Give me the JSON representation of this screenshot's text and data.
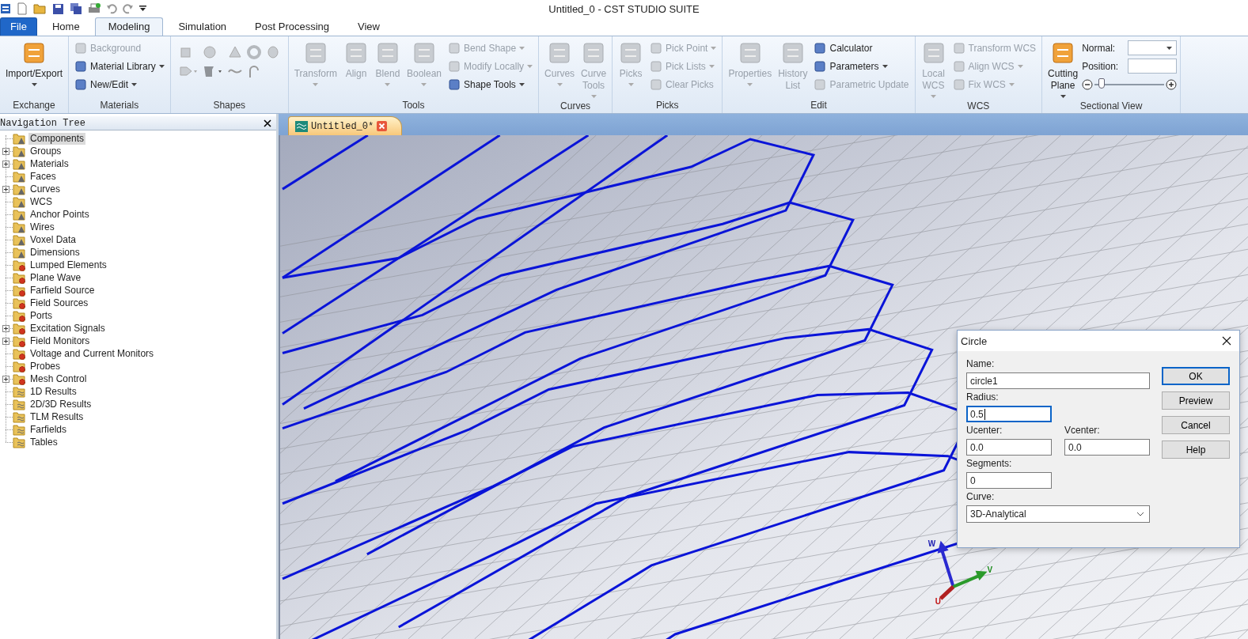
{
  "window": {
    "title": "Untitled_0 - CST STUDIO SUITE"
  },
  "ribbon": {
    "tabs": [
      {
        "label": "File",
        "kind": "file",
        "selected": false
      },
      {
        "label": "Home",
        "kind": "tab",
        "selected": false
      },
      {
        "label": "Modeling",
        "kind": "tab",
        "selected": true
      },
      {
        "label": "Simulation",
        "kind": "tab",
        "selected": false
      },
      {
        "label": "Post Processing",
        "kind": "tab",
        "selected": false
      },
      {
        "label": "View",
        "kind": "tab",
        "selected": false
      }
    ],
    "groups": [
      {
        "title": "Exchange",
        "kind": "tools",
        "items": [
          {
            "kind": "large",
            "label": "Import/Export",
            "dropdown": true,
            "disabled": false
          }
        ]
      },
      {
        "title": "Materials",
        "kind": "tools",
        "items": [
          {
            "kind": "small",
            "label": "Background",
            "dropdown": false,
            "disabled": true
          },
          {
            "kind": "small",
            "label": "Material Library",
            "dropdown": true,
            "disabled": false
          },
          {
            "kind": "small",
            "label": "New/Edit",
            "dropdown": true,
            "disabled": false
          }
        ]
      },
      {
        "title": "Shapes",
        "kind": "palette"
      },
      {
        "title": "Tools",
        "kind": "tools",
        "items": [
          {
            "kind": "large",
            "label": "Transform",
            "dropdown": true,
            "disabled": true
          },
          {
            "kind": "large",
            "label": "Align",
            "dropdown": false,
            "disabled": true
          },
          {
            "kind": "large",
            "label": "Blend",
            "dropdown": true,
            "disabled": true
          },
          {
            "kind": "large",
            "label": "Boolean",
            "dropdown": true,
            "disabled": true
          },
          {
            "kind": "small",
            "label": "Bend Shape",
            "dropdown": true,
            "disabled": true
          },
          {
            "kind": "small",
            "label": "Modify Locally",
            "dropdown": true,
            "disabled": true
          },
          {
            "kind": "small",
            "label": "Shape Tools",
            "dropdown": true,
            "disabled": false
          }
        ]
      },
      {
        "title": "Curves",
        "kind": "tools",
        "items": [
          {
            "kind": "large",
            "label": "Curves",
            "dropdown": true,
            "disabled": true
          },
          {
            "kind": "large",
            "label": "Curve Tools",
            "dropdown": true,
            "disabled": true
          }
        ]
      },
      {
        "title": "Picks",
        "kind": "tools",
        "items": [
          {
            "kind": "large",
            "label": "Picks",
            "dropdown": true,
            "disabled": true
          },
          {
            "kind": "small",
            "label": "Pick Point",
            "dropdown": true,
            "disabled": true
          },
          {
            "kind": "small",
            "label": "Pick Lists",
            "dropdown": true,
            "disabled": true
          },
          {
            "kind": "small",
            "label": "Clear Picks",
            "dropdown": false,
            "disabled": true
          }
        ]
      },
      {
        "title": "Edit",
        "kind": "tools",
        "items": [
          {
            "kind": "large",
            "label": "Properties",
            "dropdown": true,
            "disabled": true
          },
          {
            "kind": "large",
            "label": "History List",
            "dropdown": false,
            "disabled": true
          },
          {
            "kind": "small",
            "label": "Calculator",
            "dropdown": false,
            "disabled": false
          },
          {
            "kind": "small",
            "label": "Parameters",
            "dropdown": true,
            "disabled": false
          },
          {
            "kind": "small",
            "label": "Parametric Update",
            "dropdown": false,
            "disabled": true
          }
        ]
      },
      {
        "title": "WCS",
        "kind": "tools",
        "items": [
          {
            "kind": "large",
            "label": "Local WCS",
            "dropdown": true,
            "disabled": true
          },
          {
            "kind": "small",
            "label": "Transform WCS",
            "dropdown": false,
            "disabled": true
          },
          {
            "kind": "small",
            "label": "Align WCS",
            "dropdown": true,
            "disabled": true
          },
          {
            "kind": "small",
            "label": "Fix WCS",
            "dropdown": true,
            "disabled": true
          }
        ]
      },
      {
        "title": "Sectional View",
        "kind": "tools",
        "items": [
          {
            "kind": "large",
            "label": "Cutting Plane",
            "dropdown": true,
            "disabled": false
          },
          {
            "kind": "select",
            "label": "Normal:"
          },
          {
            "kind": "input",
            "label": "Position:"
          },
          {
            "kind": "slider",
            "level": 0.05
          }
        ]
      }
    ]
  },
  "navigation_tree": {
    "title": "Navigation Tree",
    "items": [
      {
        "label": "Components",
        "kind": "component",
        "expandable": false,
        "selected": true
      },
      {
        "label": "Groups",
        "kind": "component",
        "expandable": true,
        "selected": false
      },
      {
        "label": "Materials",
        "kind": "component",
        "expandable": true,
        "selected": false
      },
      {
        "label": "Faces",
        "kind": "component",
        "expandable": false,
        "selected": false
      },
      {
        "label": "Curves",
        "kind": "component",
        "expandable": true,
        "selected": false
      },
      {
        "label": "WCS",
        "kind": "component",
        "expandable": false,
        "selected": false
      },
      {
        "label": "Anchor Points",
        "kind": "component",
        "expandable": false,
        "selected": false
      },
      {
        "label": "Wires",
        "kind": "component",
        "expandable": false,
        "selected": false
      },
      {
        "label": "Voxel Data",
        "kind": "component",
        "expandable": false,
        "selected": false
      },
      {
        "label": "Dimensions",
        "kind": "component",
        "expandable": false,
        "selected": false
      },
      {
        "label": "Lumped Elements",
        "kind": "source",
        "expandable": false,
        "selected": false
      },
      {
        "label": "Plane Wave",
        "kind": "source",
        "expandable": false,
        "selected": false
      },
      {
        "label": "Farfield Source",
        "kind": "source",
        "expandable": false,
        "selected": false
      },
      {
        "label": "Field Sources",
        "kind": "source",
        "expandable": false,
        "selected": false
      },
      {
        "label": "Ports",
        "kind": "source",
        "expandable": false,
        "selected": false
      },
      {
        "label": "Excitation Signals",
        "kind": "source",
        "expandable": true,
        "selected": false
      },
      {
        "label": "Field Monitors",
        "kind": "source",
        "expandable": true,
        "selected": false
      },
      {
        "label": "Voltage and Current Monitors",
        "kind": "source",
        "expandable": false,
        "selected": false
      },
      {
        "label": "Probes",
        "kind": "source",
        "expandable": false,
        "selected": false
      },
      {
        "label": "Mesh Control",
        "kind": "source",
        "expandable": true,
        "selected": false
      },
      {
        "label": "1D Results",
        "kind": "result",
        "expandable": false,
        "selected": false
      },
      {
        "label": "2D/3D Results",
        "kind": "result",
        "expandable": false,
        "selected": false
      },
      {
        "label": "TLM Results",
        "kind": "result",
        "expandable": false,
        "selected": false
      },
      {
        "label": "Farfields",
        "kind": "result",
        "expandable": false,
        "selected": false
      },
      {
        "label": "Tables",
        "kind": "result",
        "expandable": false,
        "selected": false
      }
    ]
  },
  "document_tab": {
    "label": "Untitled_0*"
  },
  "viewport": {
    "axes": [
      "U",
      "V",
      "W"
    ]
  },
  "dialog": {
    "title": "Circle",
    "rows": [
      {
        "fields": [
          {
            "label": "Name:",
            "value": "circle1",
            "kind": "text",
            "focused": false
          }
        ]
      },
      {
        "fields": [
          {
            "label": "Radius:",
            "value": "0.5",
            "kind": "text",
            "focused": true
          }
        ]
      },
      {
        "fields": [
          {
            "label": "Ucenter:",
            "value": "0.0",
            "kind": "text",
            "focused": false
          },
          {
            "label": "Vcenter:",
            "value": "0.0",
            "kind": "text",
            "focused": false
          }
        ]
      },
      {
        "fields": [
          {
            "label": "Segments:",
            "value": "0",
            "kind": "text",
            "focused": false
          }
        ]
      },
      {
        "fields": [
          {
            "label": "Curve:",
            "value": "3D-Analytical",
            "kind": "select",
            "focused": false
          }
        ]
      }
    ],
    "buttons": [
      {
        "label": "OK",
        "default": true
      },
      {
        "label": "Preview",
        "default": false
      },
      {
        "label": "Cancel",
        "default": false
      },
      {
        "label": "Help",
        "default": false
      }
    ]
  }
}
